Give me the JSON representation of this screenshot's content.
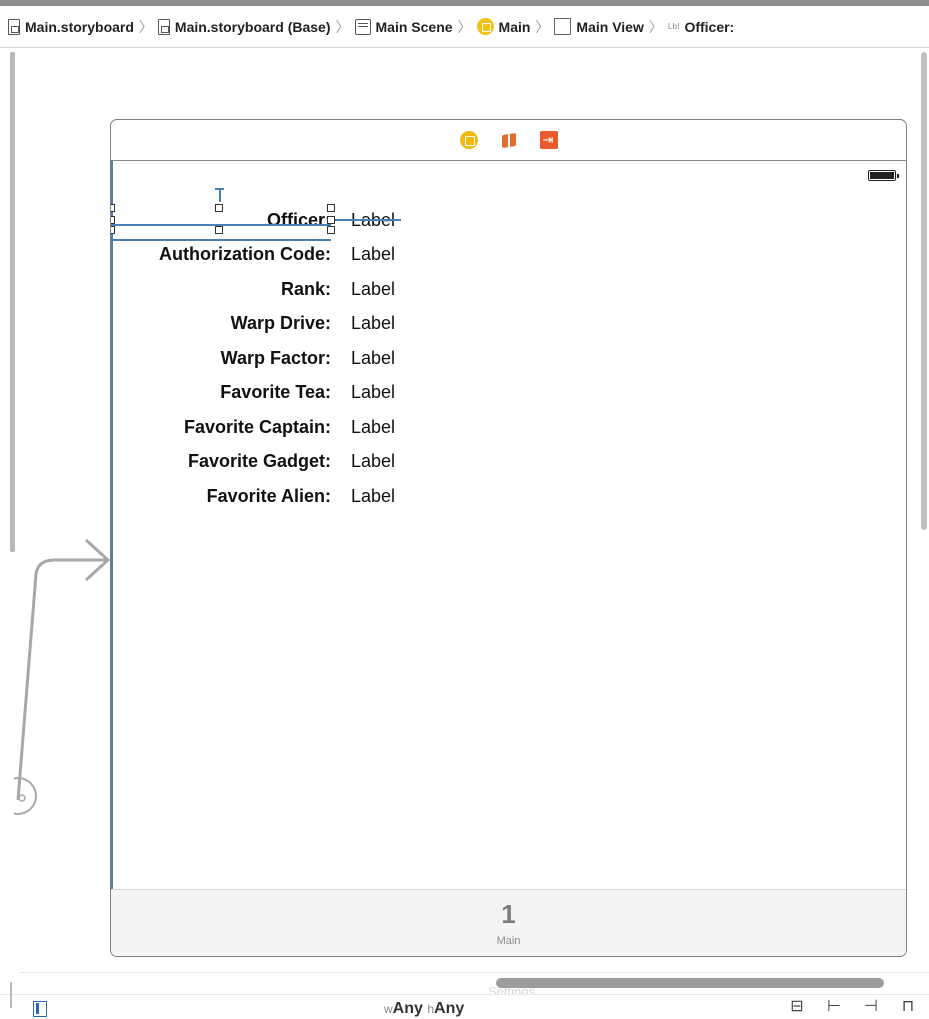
{
  "breadcrumb": {
    "items": [
      {
        "label": "Main.storyboard",
        "icon": "storyboard-file-icon"
      },
      {
        "label": "Main.storyboard (Base)",
        "icon": "storyboard-file-icon"
      },
      {
        "label": "Main Scene",
        "icon": "scene-icon"
      },
      {
        "label": "Main",
        "icon": "view-controller-icon"
      },
      {
        "label": "Main View",
        "icon": "view-icon"
      },
      {
        "label": "Officer:",
        "icon": "label-icon",
        "icon_text": "Lbl"
      }
    ]
  },
  "scene": {
    "dock_icons": [
      "view-controller-icon",
      "first-responder-icon",
      "exit-icon"
    ],
    "rows": [
      {
        "key": "Officer:",
        "value": "Label"
      },
      {
        "key": "Authorization Code:",
        "value": "Label"
      },
      {
        "key": "Rank:",
        "value": "Label"
      },
      {
        "key": "Warp Drive:",
        "value": "Label"
      },
      {
        "key": "Warp Factor:",
        "value": "Label"
      },
      {
        "key": "Favorite Tea:",
        "value": "Label"
      },
      {
        "key": "Favorite Captain:",
        "value": "Label"
      },
      {
        "key": "Favorite Gadget:",
        "value": "Label"
      },
      {
        "key": "Favorite Alien:",
        "value": "Label"
      }
    ],
    "tab_bar": {
      "item_number": "1",
      "item_label": "Main"
    }
  },
  "bottom_bar": {
    "ghost_text": "Settings",
    "size_class": {
      "w_prefix": "w",
      "w_value": "Any",
      "h_prefix": "h",
      "h_value": "Any"
    }
  },
  "colors": {
    "selection": "#4a7fb4",
    "view_controller": "#f1b80e",
    "exit": "#ea5a2a"
  }
}
